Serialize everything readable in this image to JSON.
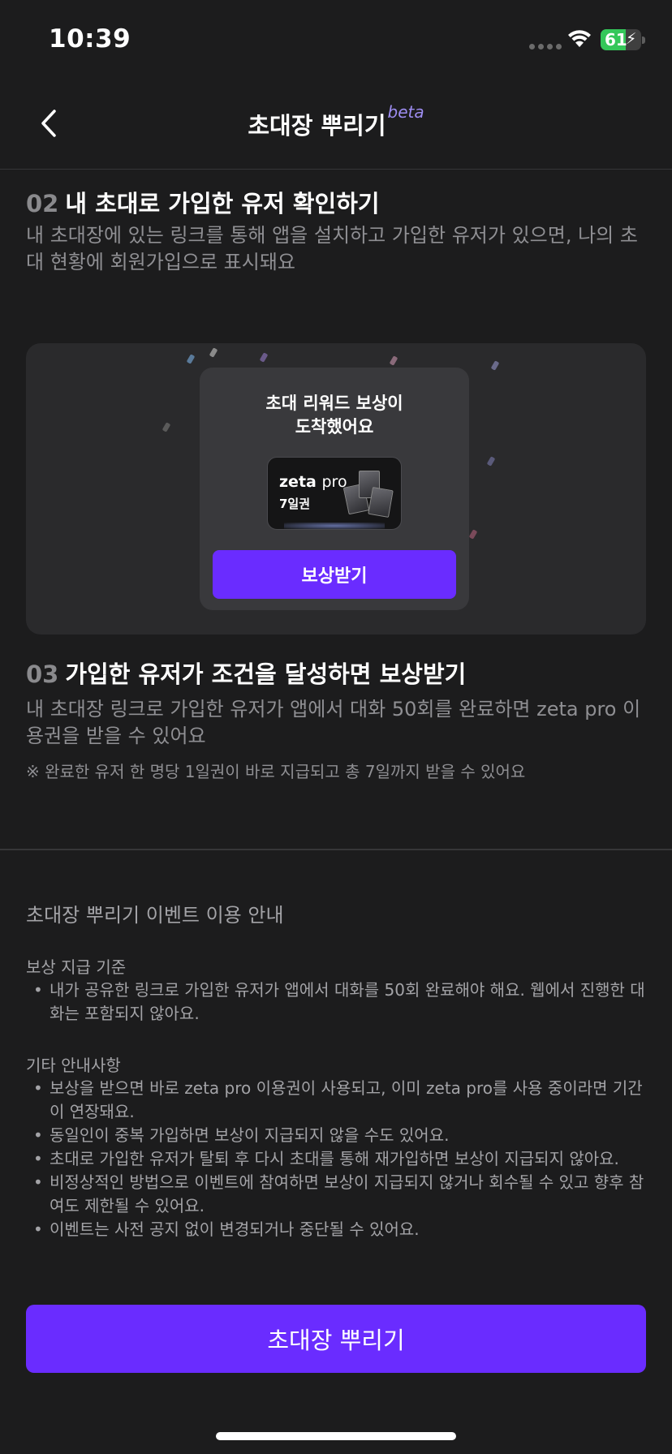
{
  "status_bar": {
    "time": "10:39",
    "battery_percent": 61,
    "battery_label": "61"
  },
  "nav": {
    "title": "초대장 뿌리기",
    "badge": "beta"
  },
  "step2": {
    "number": "02",
    "title": "내 초대로 가입한 유저 확인하기",
    "description": "내 초대장에 있는 링크를 통해 앱을 설치하고 가입한 유저가 있으면, 나의 초대 현황에 회원가입으로 표시돼요"
  },
  "reward_preview": {
    "title_line1": "초대 리워드 보상이",
    "title_line2": "도착했어요",
    "ticket_brand": "zeta",
    "ticket_tier": "pro",
    "ticket_days": "7일권",
    "button_label": "보상받기"
  },
  "step3": {
    "number": "03",
    "title": "가입한 유저가 조건을 달성하면 보상받기",
    "description": "내 초대장 링크로 가입한 유저가 앱에서 대화 50회를 완료하면 zeta pro 이용권을 받을 수 있어요",
    "note": "※ 완료한 유저 한 명당 1일권이 바로 지급되고 총 7일까지 받을 수 있어요"
  },
  "guide": {
    "title": "초대장 뿌리기 이벤트 이용 안내",
    "criteria_title": "보상 지급 기준",
    "criteria_items": [
      "내가 공유한 링크로 가입한 유저가 앱에서 대화를 50회 완료해야 해요. 웹에서 진행한 대화는 포함되지 않아요."
    ],
    "other_title": "기타 안내사항",
    "other_items": [
      "보상을 받으면 바로 zeta pro 이용권이 사용되고, 이미 zeta pro를 사용 중이라면 기간이 연장돼요.",
      "동일인이 중복 가입하면 보상이 지급되지 않을 수도 있어요.",
      "초대로 가입한 유저가 탈퇴 후 다시 초대를 통해 재가입하면 보상이 지급되지 않아요.",
      "비정상적인 방법으로 이벤트에 참여하면 보상이 지급되지 않거나 회수될 수 있고 향후 참여도 제한될 수 있어요.",
      "이벤트는 사전 공지 없이 변경되거나 중단될 수 있어요."
    ]
  },
  "cta": {
    "label": "초대장 뿌리기"
  },
  "colors": {
    "background": "#1c1c1d",
    "accent": "#6a2cff",
    "beta": "#9d8cf0",
    "battery": "#34c759"
  }
}
